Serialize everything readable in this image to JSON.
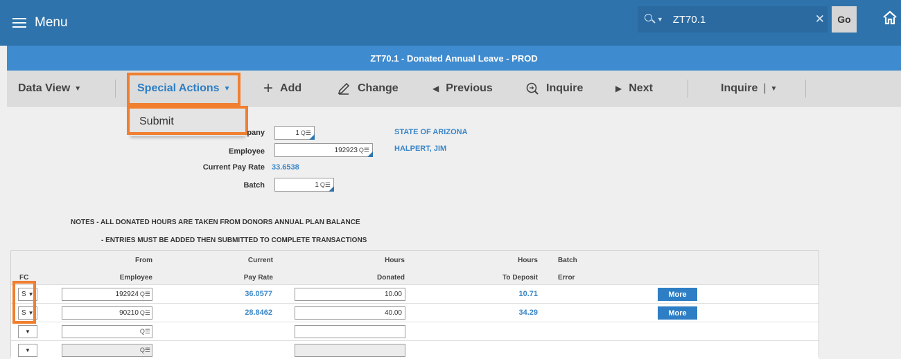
{
  "topbar": {
    "menu_label": "Menu",
    "search_value": "ZT70.1",
    "go_label": "Go"
  },
  "title": "ZT70.1 - Donated Annual Leave - PROD",
  "toolbar": {
    "data_view": "Data View",
    "special_actions": "Special Actions",
    "add": "Add",
    "change": "Change",
    "previous": "Previous",
    "inquire": "Inquire",
    "next": "Next",
    "inquire2": "Inquire"
  },
  "dropdown": {
    "submit": "Submit"
  },
  "form": {
    "company_label": "pany",
    "company_value": "1",
    "company_name": "STATE OF ARIZONA",
    "employee_label": "Employee",
    "employee_value": "192923",
    "employee_name": "HALPERT, JIM",
    "pay_rate_label": "Current Pay Rate",
    "pay_rate_value": "33.6538",
    "batch_label": "Batch",
    "batch_value": "1"
  },
  "notes": {
    "line1": "NOTES - ALL DONATED HOURS ARE TAKEN FROM DONORS ANNUAL PLAN BALANCE",
    "line2": "- ENTRIES MUST BE ADDED THEN SUBMITTED TO COMPLETE TRANSACTIONS"
  },
  "grid": {
    "headers": {
      "from": "From",
      "current": "Current",
      "hours1": "Hours",
      "hours2": "Hours",
      "batch": "Batch",
      "fc": "FC",
      "employee": "Employee",
      "pay_rate": "Pay Rate",
      "donated": "Donated",
      "to_deposit": "To Deposit",
      "error": "Error"
    },
    "rows": [
      {
        "fc": "S",
        "employee": "192924",
        "pay_rate": "36.0577",
        "hours": "10.00",
        "deposit": "10.71",
        "more": "More"
      },
      {
        "fc": "S",
        "employee": "90210",
        "pay_rate": "28.8462",
        "hours": "40.00",
        "deposit": "34.29",
        "more": "More"
      },
      {
        "fc": "",
        "employee": "",
        "pay_rate": "",
        "hours": "",
        "deposit": "",
        "more": ""
      },
      {
        "fc": "",
        "employee": "",
        "pay_rate": "",
        "hours": "",
        "deposit": "",
        "more": ""
      }
    ]
  },
  "icons": {
    "menu": "hamburger-icon",
    "search": "search-icon",
    "clear": "close-icon",
    "home": "home-icon",
    "add": "plus-icon",
    "change": "pencil-icon",
    "previous": "triangle-left-icon",
    "inquire": "magnify-icon",
    "next": "triangle-right-icon",
    "lookup": "lookup-icon"
  },
  "colors": {
    "topbar": "#2e73ab",
    "titlebar": "#3f8bd0",
    "accent": "#2d7ec4",
    "highlight": "#f07f2f"
  }
}
